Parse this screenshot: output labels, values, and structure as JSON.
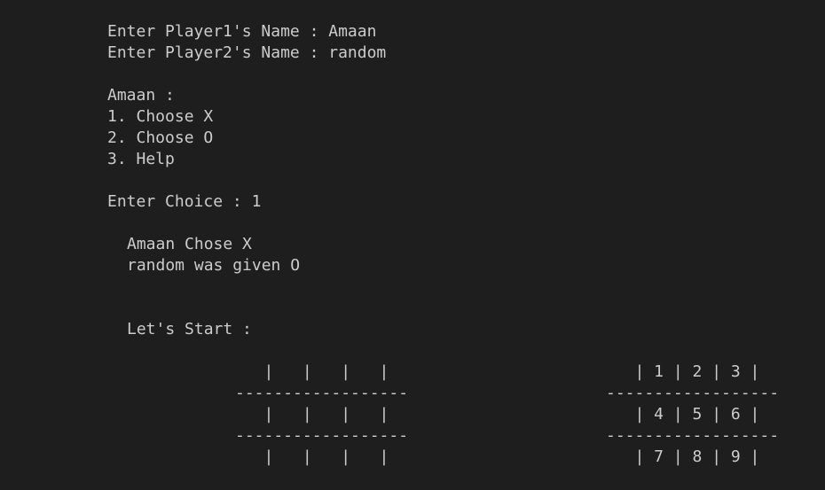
{
  "terminal": {
    "prompt_p1_label": "Enter Player1's Name : ",
    "player1_name": "Amaan",
    "prompt_p2_label": "Enter Player2's Name : ",
    "player2_name": "random",
    "menu_header": "Amaan :",
    "menu_items": [
      "1. Choose X",
      "2. Choose O",
      "3. Help"
    ],
    "choice_label": "Enter Choice : ",
    "choice_value": "1",
    "result_line1": "Amaan Chose X",
    "result_line2": "random was given O",
    "start_text": "Let's Start :",
    "board_left": [
      "   |   |   |   |",
      "------------------",
      "   |   |   |   |",
      "------------------",
      "   |   |   |   |"
    ],
    "board_right": [
      "   | 1 | 2 | 3 |",
      "------------------",
      "   | 4 | 5 | 6 |",
      "------------------",
      "   | 7 | 8 | 9 |"
    ]
  }
}
